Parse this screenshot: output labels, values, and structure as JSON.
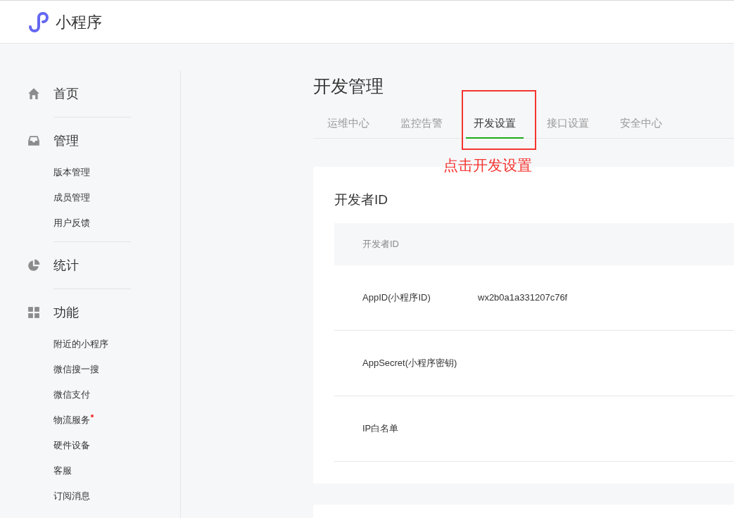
{
  "header": {
    "title": "小程序"
  },
  "sidebar": [
    {
      "kind": "section",
      "label": "首页"
    },
    {
      "kind": "section",
      "label": "管理",
      "items": [
        {
          "label": "版本管理",
          "dot": false
        },
        {
          "label": "成员管理",
          "dot": false
        },
        {
          "label": "用户反馈",
          "dot": false
        }
      ]
    },
    {
      "kind": "section",
      "label": "统计"
    },
    {
      "kind": "section",
      "label": "功能",
      "items": [
        {
          "label": "附近的小程序",
          "dot": false
        },
        {
          "label": "微信搜一搜",
          "dot": false
        },
        {
          "label": "微信支付",
          "dot": false
        },
        {
          "label": "物流服务",
          "dot": true
        },
        {
          "label": "硬件设备",
          "dot": false
        },
        {
          "label": "客服",
          "dot": false
        },
        {
          "label": "订阅消息",
          "dot": false
        }
      ]
    }
  ],
  "page_title": "开发管理",
  "tabs": [
    {
      "label": "运维中心",
      "selected": false
    },
    {
      "label": "监控告警",
      "selected": false
    },
    {
      "label": "开发设置",
      "selected": true
    },
    {
      "label": "接口设置",
      "selected": false
    },
    {
      "label": "安全中心",
      "selected": false
    }
  ],
  "annotation": {
    "text": "点击开发设置"
  },
  "card": {
    "title": "开发者ID",
    "table": {
      "columns": [
        "开发者ID"
      ],
      "rows": [
        [
          "AppID(小程序ID)",
          "wx2b0a1a331207c76f"
        ],
        [
          "AppSecret(小程序密钥)"
        ],
        [
          "IP白名单"
        ]
      ]
    }
  }
}
